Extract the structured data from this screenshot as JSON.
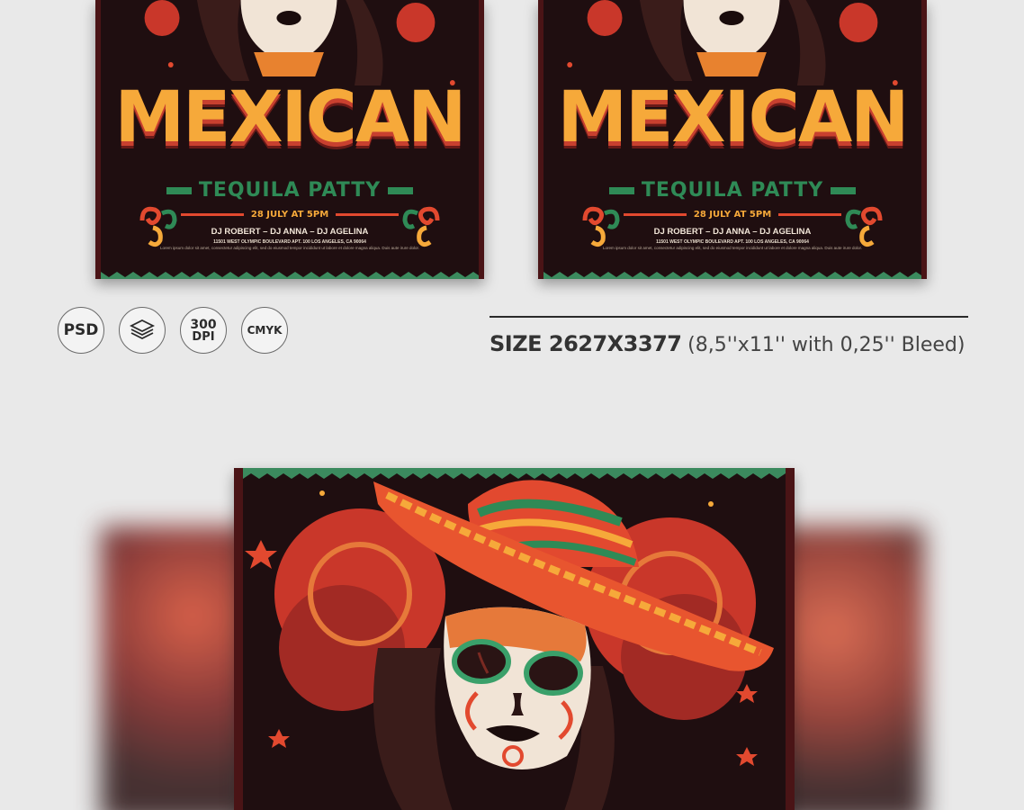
{
  "colors": {
    "background": "#e9e9e9",
    "flyer_bg": "#1f0e10",
    "title_orange": "#f6a93a",
    "title_red": "#c8402f",
    "green": "#2f8a56",
    "accent_red": "#e2492f"
  },
  "flyer": {
    "title": "MEXICAN",
    "subtitle": "TEQUILA PATTY",
    "date": "28 JULY AT 5PM",
    "djs": "DJ ROBERT – DJ ANNA – DJ AGELINA",
    "address": "11501 WEST OLYMPIC BOULEVARD APT. 100 LOS ANGELES, CA 90064",
    "lorem": "Lorem ipsum dolor sit amet, consectetur adipiscing elit, sed do eiusmod tempor incididunt ut labore et dolore magna aliqua. Duis aute irure dolor."
  },
  "badges": {
    "psd": "PSD",
    "layers_icon": "layers-icon",
    "dpi_value": "300",
    "dpi_unit": "DPI",
    "cmyk": "CMYK"
  },
  "size_info": {
    "bold": "SIZE 2627X3377",
    "light": "(8,5''x11'' with 0,25'' Bleed)"
  }
}
